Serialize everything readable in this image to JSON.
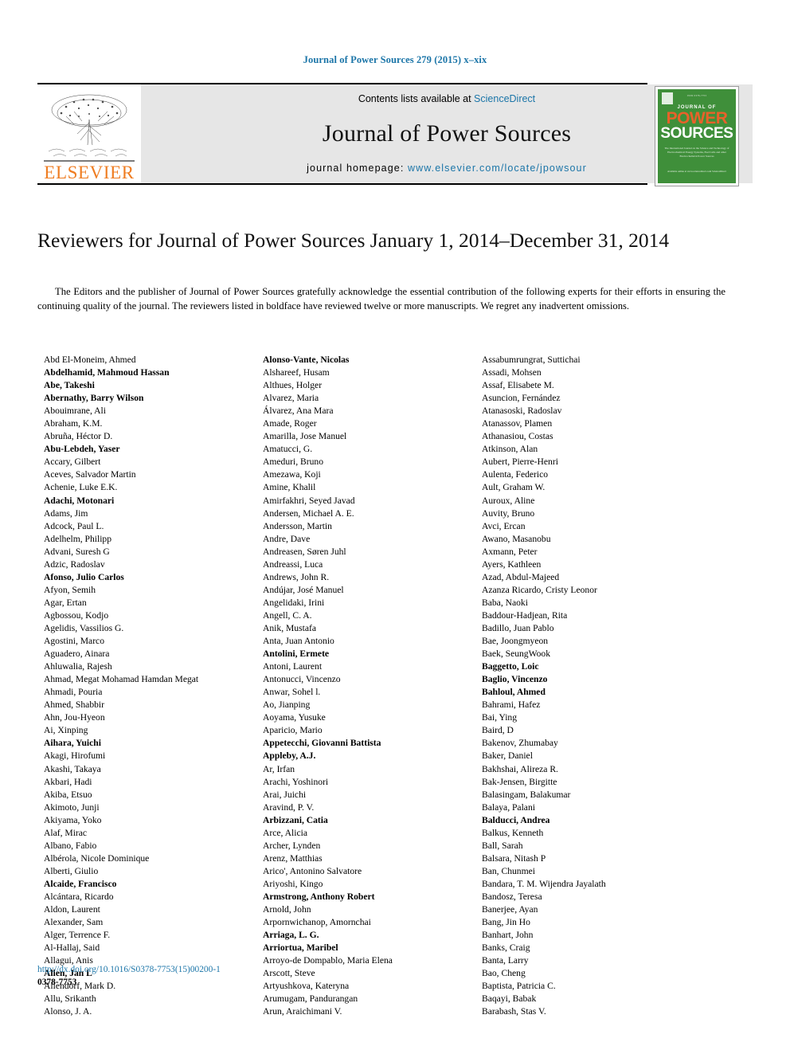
{
  "running_head": "Journal of Power Sources 279 (2015) x–xix",
  "masthead": {
    "contents_prefix": "Contents lists available at ",
    "sciencedirect_label": "ScienceDirect",
    "journal_title": "Journal of Power Sources",
    "homepage_prefix": "journal homepage: ",
    "homepage_url": "www.elsevier.com/locate/jpowsour",
    "publisher_name": "ELSEVIER",
    "accent_blue": "#1b75a8",
    "elsevier_orange": "#ef7d22"
  },
  "cover": {
    "top_line": "ISSN 0378-7753",
    "journal_of": "JOURNAL OF",
    "power": "POWER",
    "sources": "SOURCES",
    "subtitle": "The International Journal on the Science and Technology of Electrochemical Energy Systems, Fuel Cells and other Electrochemical Power Sources",
    "footer": "Available online at www.sciencedirect.com ScienceDirect",
    "cover_green": "#3f8f3a",
    "cover_orange": "#e8622a"
  },
  "article": {
    "title": "Reviewers for Journal of Power Sources January 1, 2014–December 31, 2014",
    "intro": "The Editors and the publisher of Journal of Power Sources gratefully acknowledge the essential contribution of the following experts for their efforts in ensuring the continuing quality of the journal. The reviewers listed in boldface have reviewed twelve or more manuscripts. We regret any inadvertent omissions."
  },
  "footer": {
    "doi": "http://dx.doi.org/10.1016/S0378-7753(15)00200-1",
    "issn": "0378-7753"
  },
  "reviewer_columns": [
    {
      "column": 1,
      "names": [
        {
          "text": "Abd El-Moneim, Ahmed",
          "bold": false
        },
        {
          "text": "Abdelhamid, Mahmoud Hassan",
          "bold": true
        },
        {
          "text": "Abe, Takeshi",
          "bold": true
        },
        {
          "text": "Abernathy, Barry Wilson",
          "bold": true
        },
        {
          "text": "Abouimrane, Ali",
          "bold": false
        },
        {
          "text": "Abraham, K.M.",
          "bold": false
        },
        {
          "text": "Abruña, Héctor D.",
          "bold": false
        },
        {
          "text": "Abu-Lebdeh, Yaser",
          "bold": true
        },
        {
          "text": "Accary, Gilbert",
          "bold": false
        },
        {
          "text": "Aceves, Salvador Martin",
          "bold": false
        },
        {
          "text": "Achenie, Luke E.K.",
          "bold": false
        },
        {
          "text": "Adachi, Motonari",
          "bold": true
        },
        {
          "text": "Adams, Jim",
          "bold": false
        },
        {
          "text": "Adcock, Paul L.",
          "bold": false
        },
        {
          "text": "Adelhelm, Philipp",
          "bold": false
        },
        {
          "text": "Advani, Suresh G",
          "bold": false
        },
        {
          "text": "Adzic, Radoslav",
          "bold": false
        },
        {
          "text": "Afonso, Julio Carlos",
          "bold": true
        },
        {
          "text": "Afyon, Semih",
          "bold": false
        },
        {
          "text": "Agar, Ertan",
          "bold": false
        },
        {
          "text": "Agbossou, Kodjo",
          "bold": false
        },
        {
          "text": "Agelidis, Vassilios G.",
          "bold": false
        },
        {
          "text": "Agostini, Marco",
          "bold": false
        },
        {
          "text": "Aguadero, Ainara",
          "bold": false
        },
        {
          "text": "Ahluwalia, Rajesh",
          "bold": false
        },
        {
          "text": "Ahmad, Megat Mohamad Hamdan Megat",
          "bold": false
        },
        {
          "text": "Ahmadi, Pouria",
          "bold": false
        },
        {
          "text": "Ahmed, Shabbir",
          "bold": false
        },
        {
          "text": "Ahn, Jou-Hyeon",
          "bold": false
        },
        {
          "text": "Ai, Xinping",
          "bold": false
        },
        {
          "text": "Aihara, Yuichi",
          "bold": true
        },
        {
          "text": "Akagi, Hirofumi",
          "bold": false
        },
        {
          "text": "Akashi, Takaya",
          "bold": false
        },
        {
          "text": "Akbari, Hadi",
          "bold": false
        },
        {
          "text": "Akiba, Etsuo",
          "bold": false
        },
        {
          "text": "Akimoto, Junji",
          "bold": false
        },
        {
          "text": "Akiyama, Yoko",
          "bold": false
        },
        {
          "text": "Alaf, Mirac",
          "bold": false
        },
        {
          "text": "Albano, Fabio",
          "bold": false
        },
        {
          "text": "Albérola, Nicole Dominique",
          "bold": false
        },
        {
          "text": "Alberti, Giulio",
          "bold": false
        },
        {
          "text": "Alcaide, Francisco",
          "bold": true
        },
        {
          "text": "Alcántara, Ricardo",
          "bold": false
        },
        {
          "text": "Aldon, Laurent",
          "bold": false
        },
        {
          "text": "Alexander, Sam",
          "bold": false
        },
        {
          "text": "Alger, Terrence F.",
          "bold": false
        },
        {
          "text": "Al-Hallaj, Said",
          "bold": false
        },
        {
          "text": "Allagui, Anis",
          "bold": false
        },
        {
          "text": "Allen, Jan L",
          "bold": true
        },
        {
          "text": "Allendorf, Mark D.",
          "bold": false
        },
        {
          "text": "Allu, Srikanth",
          "bold": false
        },
        {
          "text": "Alonso, J. A.",
          "bold": false
        }
      ]
    },
    {
      "column": 2,
      "names": [
        {
          "text": "Alonso-Vante, Nicolas",
          "bold": true
        },
        {
          "text": "Alshareef, Husam",
          "bold": false
        },
        {
          "text": "Althues, Holger",
          "bold": false
        },
        {
          "text": "Alvarez, Maria",
          "bold": false
        },
        {
          "text": "Álvarez, Ana Mara",
          "bold": false
        },
        {
          "text": "Amade, Roger",
          "bold": false
        },
        {
          "text": "Amarilla, Jose Manuel",
          "bold": false
        },
        {
          "text": "Amatucci, G.",
          "bold": false
        },
        {
          "text": "Ameduri, Bruno",
          "bold": false
        },
        {
          "text": "Amezawa, Koji",
          "bold": false
        },
        {
          "text": "Amine, Khalil",
          "bold": false
        },
        {
          "text": "Amirfakhri, Seyed Javad",
          "bold": false
        },
        {
          "text": "Andersen, Michael A. E.",
          "bold": false
        },
        {
          "text": "Andersson, Martin",
          "bold": false
        },
        {
          "text": "Andre, Dave",
          "bold": false
        },
        {
          "text": "Andreasen, Søren Juhl",
          "bold": false
        },
        {
          "text": "Andreassi, Luca",
          "bold": false
        },
        {
          "text": "Andrews, John R.",
          "bold": false
        },
        {
          "text": "Andújar, José Manuel",
          "bold": false
        },
        {
          "text": "Angelidaki, Irini",
          "bold": false
        },
        {
          "text": "Angell, C. A.",
          "bold": false
        },
        {
          "text": "Anik, Mustafa",
          "bold": false
        },
        {
          "text": "Anta, Juan Antonio",
          "bold": false
        },
        {
          "text": "Antolini, Ermete",
          "bold": true
        },
        {
          "text": "Antoni, Laurent",
          "bold": false
        },
        {
          "text": "Antonucci, Vincenzo",
          "bold": false
        },
        {
          "text": "Anwar, Sohel l.",
          "bold": false
        },
        {
          "text": "Ao, Jianping",
          "bold": false
        },
        {
          "text": "Aoyama, Yusuke",
          "bold": false
        },
        {
          "text": "Aparicio, Mario",
          "bold": false
        },
        {
          "text": "Appetecchi, Giovanni Battista",
          "bold": true
        },
        {
          "text": "Appleby, A.J.",
          "bold": true
        },
        {
          "text": "Ar, Irfan",
          "bold": false
        },
        {
          "text": "Arachi, Yoshinori",
          "bold": false
        },
        {
          "text": "Arai, Juichi",
          "bold": false
        },
        {
          "text": "Aravind, P. V.",
          "bold": false
        },
        {
          "text": "Arbizzani, Catia",
          "bold": true
        },
        {
          "text": "Arce, Alicia",
          "bold": false
        },
        {
          "text": "Archer, Lynden",
          "bold": false
        },
        {
          "text": "Arenz, Matthias",
          "bold": false
        },
        {
          "text": "Arico', Antonino Salvatore",
          "bold": false
        },
        {
          "text": "Ariyoshi, Kingo",
          "bold": false
        },
        {
          "text": "Armstrong, Anthony Robert",
          "bold": true
        },
        {
          "text": "Arnold, John",
          "bold": false
        },
        {
          "text": "Arpornwichanop, Amornchai",
          "bold": false
        },
        {
          "text": "Arriaga, L. G.",
          "bold": true
        },
        {
          "text": "Arriortua, Maribel",
          "bold": true
        },
        {
          "text": "Arroyo-de Dompablo, Maria Elena",
          "bold": false
        },
        {
          "text": "Arscott, Steve",
          "bold": false
        },
        {
          "text": "Artyushkova, Kateryna",
          "bold": false
        },
        {
          "text": "Arumugam, Pandurangan",
          "bold": false
        },
        {
          "text": "Arun, Araichimani V.",
          "bold": false
        }
      ]
    },
    {
      "column": 3,
      "names": [
        {
          "text": "Assabumrungrat, Suttichai",
          "bold": false
        },
        {
          "text": "Assadi, Mohsen",
          "bold": false
        },
        {
          "text": "Assaf, Elisabete M.",
          "bold": false
        },
        {
          "text": "Asuncion, Fernández",
          "bold": false
        },
        {
          "text": "Atanasoski, Radoslav",
          "bold": false
        },
        {
          "text": "Atanassov, Plamen",
          "bold": false
        },
        {
          "text": "Athanasiou, Costas",
          "bold": false
        },
        {
          "text": "Atkinson, Alan",
          "bold": false
        },
        {
          "text": "Aubert, Pierre-Henri",
          "bold": false
        },
        {
          "text": "Aulenta, Federico",
          "bold": false
        },
        {
          "text": "Ault, Graham W.",
          "bold": false
        },
        {
          "text": "Auroux, Aline",
          "bold": false
        },
        {
          "text": "Auvity, Bruno",
          "bold": false
        },
        {
          "text": "Avci, Ercan",
          "bold": false
        },
        {
          "text": "Awano, Masanobu",
          "bold": false
        },
        {
          "text": "Axmann, Peter",
          "bold": false
        },
        {
          "text": "Ayers, Kathleen",
          "bold": false
        },
        {
          "text": "Azad, Abdul-Majeed",
          "bold": false
        },
        {
          "text": "Azanza Ricardo, Cristy Leonor",
          "bold": false
        },
        {
          "text": "Baba, Naoki",
          "bold": false
        },
        {
          "text": "Baddour-Hadjean, Rita",
          "bold": false
        },
        {
          "text": "Badillo, Juan Pablo",
          "bold": false
        },
        {
          "text": "Bae, Joongmyeon",
          "bold": false
        },
        {
          "text": "Baek, SeungWook",
          "bold": false
        },
        {
          "text": "Baggetto, Loic",
          "bold": true
        },
        {
          "text": "Baglio, Vincenzo",
          "bold": true
        },
        {
          "text": "Bahloul, Ahmed",
          "bold": true
        },
        {
          "text": "Bahrami, Hafez",
          "bold": false
        },
        {
          "text": "Bai, Ying",
          "bold": false
        },
        {
          "text": "Baird, D",
          "bold": false
        },
        {
          "text": "Bakenov, Zhumabay",
          "bold": false
        },
        {
          "text": "Baker, Daniel",
          "bold": false
        },
        {
          "text": "Bakhshai, Alireza R.",
          "bold": false
        },
        {
          "text": "Bak-Jensen, Birgitte",
          "bold": false
        },
        {
          "text": "Balasingam, Balakumar",
          "bold": false
        },
        {
          "text": "Balaya, Palani",
          "bold": false
        },
        {
          "text": "Balducci, Andrea",
          "bold": true
        },
        {
          "text": "Balkus, Kenneth",
          "bold": false
        },
        {
          "text": "Ball, Sarah",
          "bold": false
        },
        {
          "text": "Balsara, Nitash P",
          "bold": false
        },
        {
          "text": "Ban, Chunmei",
          "bold": false
        },
        {
          "text": "Bandara, T. M. Wijendra Jayalath",
          "bold": false
        },
        {
          "text": "Bandosz, Teresa",
          "bold": false
        },
        {
          "text": "Banerjee, Ayan",
          "bold": false
        },
        {
          "text": "Bang, Jin Ho",
          "bold": false
        },
        {
          "text": "Banhart, John",
          "bold": false
        },
        {
          "text": "Banks, Craig",
          "bold": false
        },
        {
          "text": "Banta, Larry",
          "bold": false
        },
        {
          "text": "Bao, Cheng",
          "bold": false
        },
        {
          "text": "Baptista, Patricia C.",
          "bold": false
        },
        {
          "text": "Baqayi, Babak",
          "bold": false
        },
        {
          "text": "Barabash, Stas V.",
          "bold": false
        }
      ]
    }
  ]
}
